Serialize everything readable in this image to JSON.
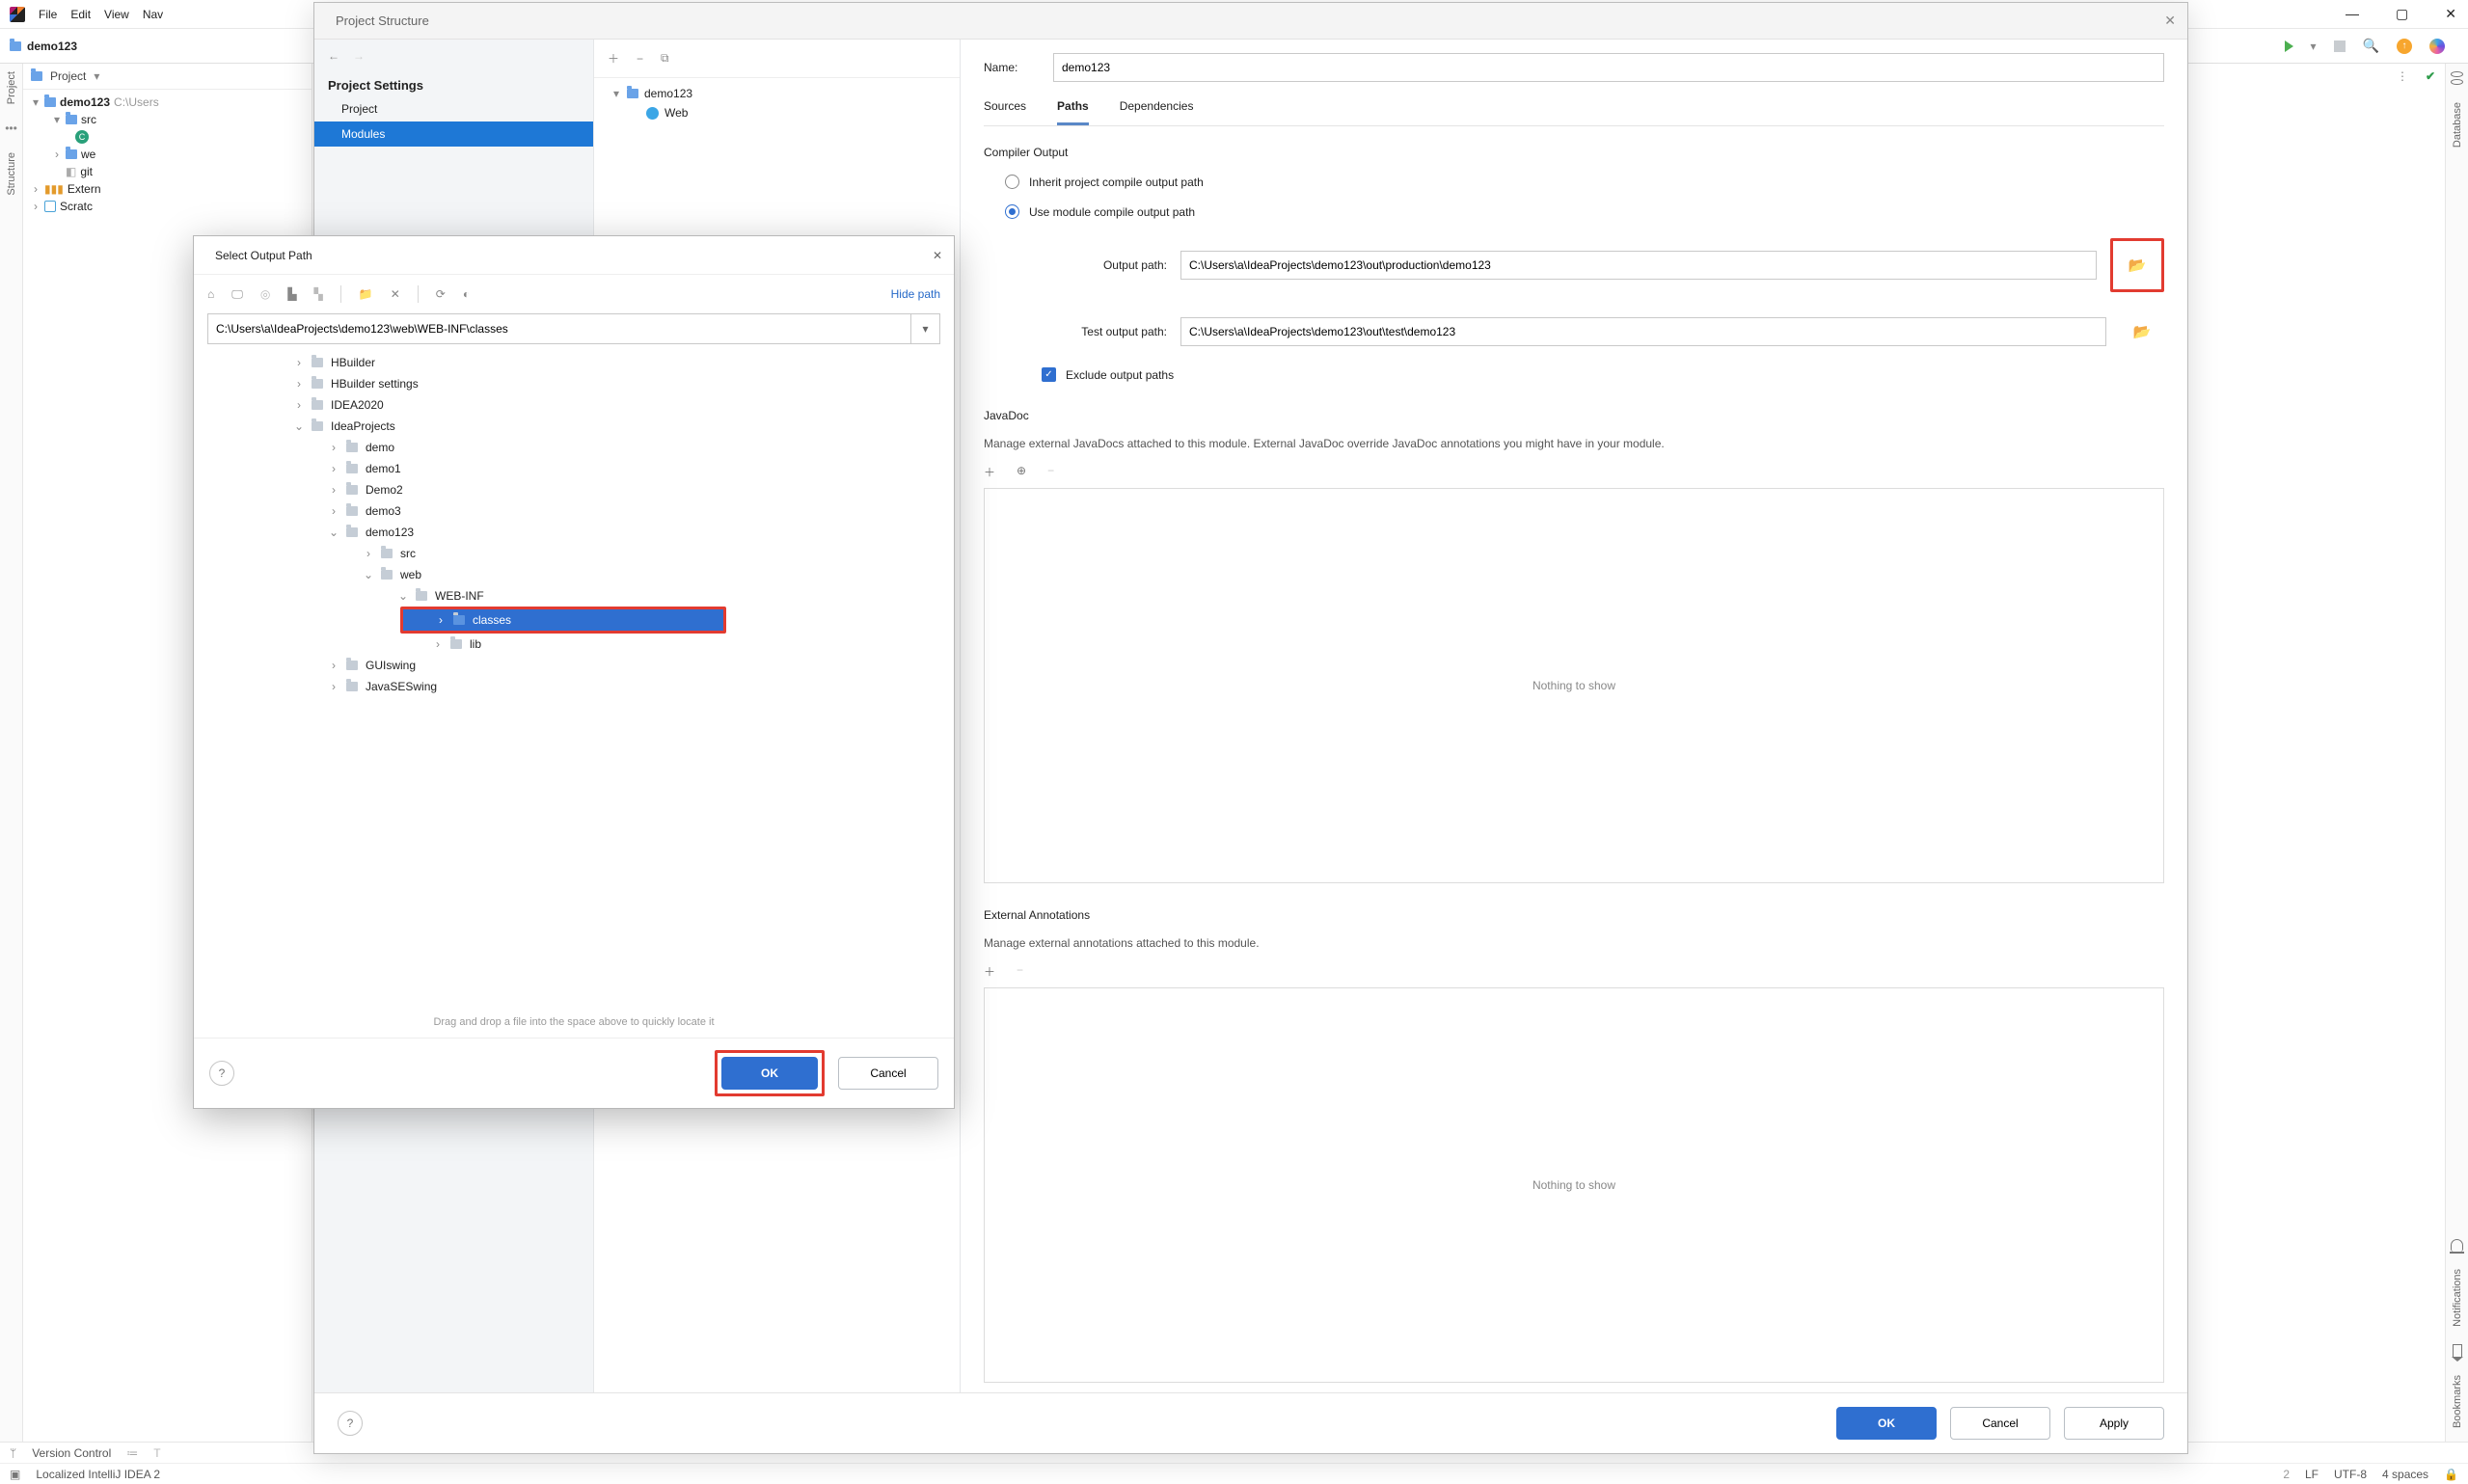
{
  "menubar": {
    "items": [
      "File",
      "Edit",
      "View",
      "Nav"
    ]
  },
  "breadcrumb": {
    "project": "demo123"
  },
  "projectPanel": {
    "title": "Project",
    "root": "demo123",
    "rootPath": "C:\\Users",
    "children": [
      "src",
      "we",
      "git",
      "Extern",
      "Scratc"
    ],
    "srcChildIcon": "c-icon"
  },
  "rightGutter": {
    "labels": [
      "Database",
      "Notifications",
      "Bookmarks"
    ]
  },
  "statusbar": {
    "versionControl": "Version Control",
    "localized": "Localized IntelliJ IDEA 2",
    "lf": "LF",
    "encoding": "UTF-8",
    "indent": "4 spaces"
  },
  "psDialog": {
    "title": "Project Structure",
    "sidebarHeading": "Project Settings",
    "sidebarItems": [
      "Project",
      "Modules"
    ],
    "selectedSidebar": "Modules",
    "midTree": {
      "root": "demo123",
      "child": "Web"
    },
    "nameLabel": "Name:",
    "nameValue": "demo123",
    "tabs": [
      "Sources",
      "Paths",
      "Dependencies"
    ],
    "activeTab": "Paths",
    "compilerOutput": {
      "heading": "Compiler Output",
      "radioInherit": "Inherit project compile output path",
      "radioModule": "Use module compile output path",
      "selected": "module",
      "outputPathLabel": "Output path:",
      "outputPathValue": "C:\\Users\\a\\IdeaProjects\\demo123\\out\\production\\demo123",
      "testOutputPathLabel": "Test output path:",
      "testOutputPathValue": "C:\\Users\\a\\IdeaProjects\\demo123\\out\\test\\demo123",
      "excludeLabel": "Exclude output paths"
    },
    "javadoc": {
      "heading": "JavaDoc",
      "desc": "Manage external JavaDocs attached to this module. External JavaDoc override JavaDoc annotations you might have in your module.",
      "empty": "Nothing to show"
    },
    "annotations": {
      "heading": "External Annotations",
      "desc": "Manage external annotations attached to this module.",
      "empty": "Nothing to show"
    },
    "buttons": {
      "ok": "OK",
      "cancel": "Cancel",
      "apply": "Apply"
    }
  },
  "sopDialog": {
    "title": "Select Output Path",
    "hidePath": "Hide path",
    "pathValue": "C:\\Users\\a\\IdeaProjects\\demo123\\web\\WEB-INF\\classes",
    "tree": {
      "l0": [
        {
          "name": "HBuilder"
        },
        {
          "name": "HBuilder settings"
        },
        {
          "name": "IDEA2020"
        },
        {
          "name": "IdeaProjects",
          "expanded": true,
          "children": [
            {
              "name": "demo"
            },
            {
              "name": "demo1"
            },
            {
              "name": "Demo2"
            },
            {
              "name": "demo3"
            },
            {
              "name": "demo123",
              "expanded": true,
              "children": [
                {
                  "name": "src"
                },
                {
                  "name": "web",
                  "expanded": true,
                  "children": [
                    {
                      "name": "WEB-INF",
                      "expanded": true,
                      "children": [
                        {
                          "name": "classes",
                          "selected": true,
                          "highlighted": true
                        },
                        {
                          "name": "lib"
                        }
                      ]
                    }
                  ]
                }
              ]
            },
            {
              "name": "GUIswing"
            },
            {
              "name": "JavaSESwing"
            }
          ]
        }
      ]
    },
    "hint": "Drag and drop a file into the space above to quickly locate it",
    "buttons": {
      "ok": "OK",
      "cancel": "Cancel"
    }
  }
}
